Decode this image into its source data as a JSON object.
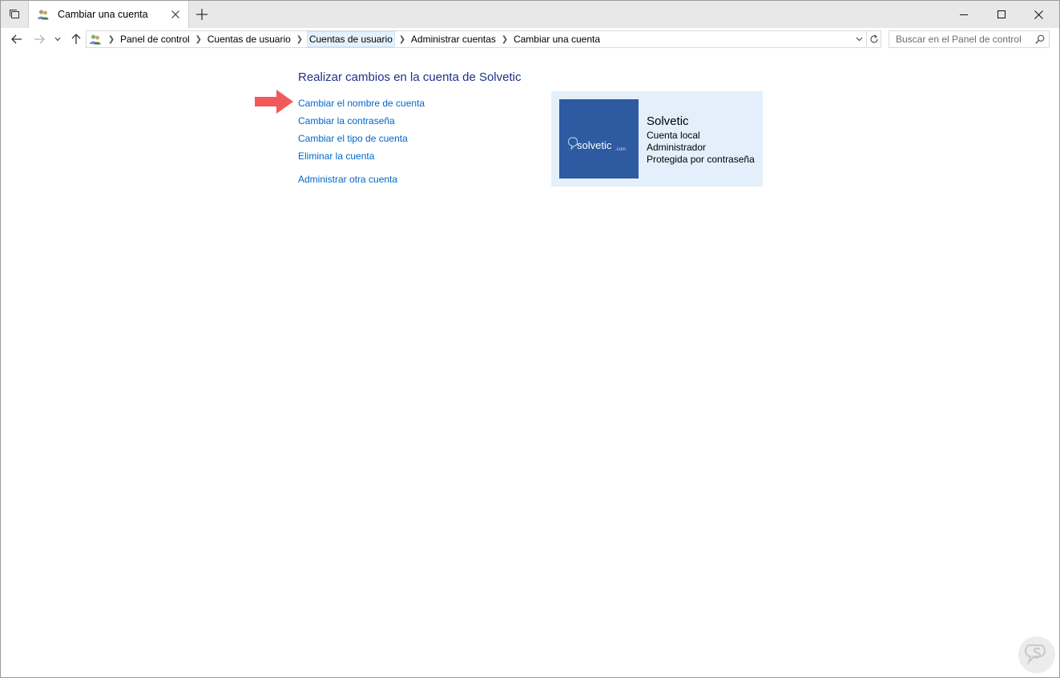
{
  "window": {
    "tab_title": "Cambiar una cuenta"
  },
  "breadcrumb": {
    "items": [
      "Panel de control",
      "Cuentas de usuario",
      "Cuentas de usuario",
      "Administrar cuentas",
      "Cambiar una cuenta"
    ]
  },
  "search": {
    "placeholder": "Buscar en el Panel de control"
  },
  "main": {
    "heading": "Realizar cambios en la cuenta de Solvetic",
    "links": [
      "Cambiar el nombre de cuenta",
      "Cambiar la contraseña",
      "Cambiar el tipo de cuenta",
      "Eliminar la cuenta",
      "Administrar otra cuenta"
    ]
  },
  "account": {
    "name": "Solvetic",
    "type": "Cuenta local",
    "role": "Administrador",
    "protection": "Protegida por contraseña",
    "logo_text": "solvetic",
    "logo_suffix": ".com"
  },
  "colors": {
    "heading": "#1e3287",
    "link": "#0066cc",
    "card_bg": "#e3f0fb",
    "avatar_bg": "#2e5aa1",
    "arrow": "#f15a5a"
  },
  "icons": {
    "tabs_menu": "tabs-menu-icon",
    "tab": "user-accounts-icon",
    "search": "search-icon",
    "refresh": "refresh-icon"
  }
}
